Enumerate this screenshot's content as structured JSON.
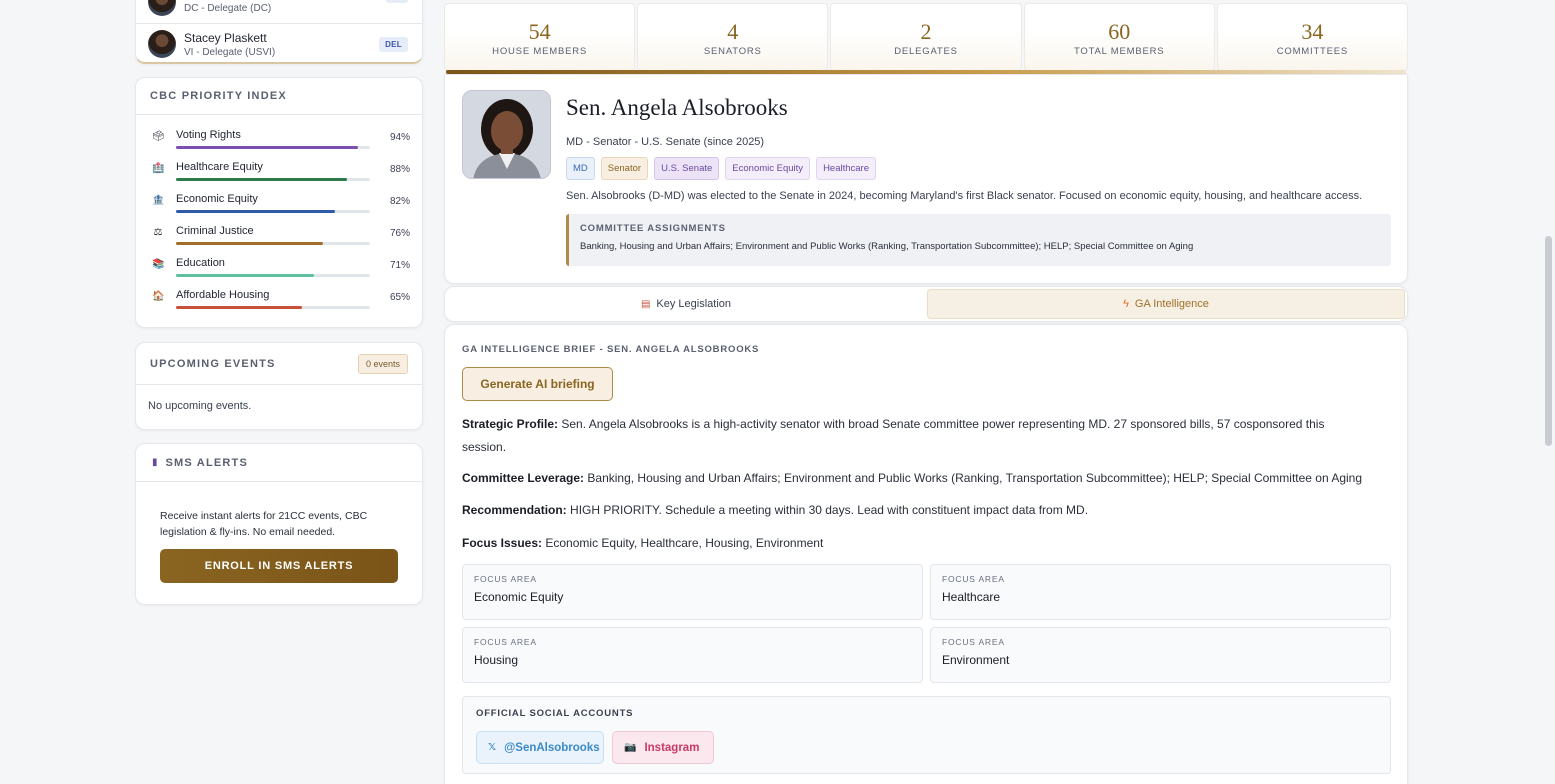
{
  "members": [
    {
      "name": "",
      "role": "DC - Delegate (DC)",
      "badge": ""
    },
    {
      "name": "Stacey Plaskett",
      "role": "VI - Delegate (USVI)",
      "badge": "DEL"
    }
  ],
  "priority_index": {
    "title": "CBC PRIORITY INDEX",
    "items": [
      {
        "label": "Voting Rights",
        "percent": "94%",
        "value": 0.94,
        "color": "#7a4fb0",
        "icon": "ballot-box-icon",
        "glyph": "🗳"
      },
      {
        "label": "Healthcare Equity",
        "percent": "88%",
        "value": 0.88,
        "color": "#2f7a4a",
        "icon": "hospital-icon",
        "glyph": "🏥"
      },
      {
        "label": "Economic Equity",
        "percent": "82%",
        "value": 0.82,
        "color": "#2f5aa8",
        "icon": "bank-icon",
        "glyph": "🏦"
      },
      {
        "label": "Criminal Justice",
        "percent": "76%",
        "value": 0.76,
        "color": "#a0702a",
        "icon": "scales-icon",
        "glyph": "⚖"
      },
      {
        "label": "Education",
        "percent": "71%",
        "value": 0.71,
        "color": "#5fbfa0",
        "icon": "books-icon",
        "glyph": "📚"
      },
      {
        "label": "Affordable Housing",
        "percent": "65%",
        "value": 0.65,
        "color": "#c8503a",
        "icon": "house-icon",
        "glyph": "🏠"
      }
    ]
  },
  "events": {
    "title": "UPCOMING EVENTS",
    "badge": "0 events",
    "empty": "No upcoming events."
  },
  "sms": {
    "title": "SMS ALERTS",
    "text": "Receive instant alerts for 21CC events, CBC legislation & fly-ins. No email needed.",
    "button": "ENROLL IN SMS ALERTS",
    "icon": "phone-icon"
  },
  "stats": [
    {
      "num": "54",
      "label": "HOUSE MEMBERS"
    },
    {
      "num": "4",
      "label": "SENATORS"
    },
    {
      "num": "2",
      "label": "DELEGATES"
    },
    {
      "num": "60",
      "label": "TOTAL MEMBERS"
    },
    {
      "num": "34",
      "label": "COMMITTEES"
    }
  ],
  "profile": {
    "name": "Sen. Angela Alsobrooks",
    "subtitle": "MD - Senator - U.S. Senate (since 2025)",
    "tags": [
      {
        "label": "MD",
        "color": "#3a6ab8",
        "bg": "#eaf1fb",
        "border": "#c8d8ef"
      },
      {
        "label": "Senator",
        "color": "#8a6520",
        "bg": "#f8efe2",
        "border": "#e8d8b8"
      },
      {
        "label": "U.S. Senate",
        "color": "#6a4aa0",
        "bg": "#ece4f6",
        "border": "#d4c4ec"
      },
      {
        "label": "Economic Equity",
        "color": "#6a4aa0",
        "bg": "#f3eefa",
        "border": "#e0d4f0"
      },
      {
        "label": "Healthcare",
        "color": "#6a4aa0",
        "bg": "#f3eefa",
        "border": "#e0d4f0"
      }
    ],
    "bio": "Sen. Alsobrooks (D-MD) was elected to the Senate in 2024, becoming Maryland's first Black senator. Focused on economic equity, housing, and healthcare access.",
    "committee_title": "COMMITTEE ASSIGNMENTS",
    "committees": "Banking, Housing and Urban Affairs; Environment and Public Works (Ranking, Transportation Subcommittee); HELP; Special Committee on Aging"
  },
  "tabs": [
    {
      "label": "Key Legislation",
      "icon": "clipboard-icon",
      "active": false
    },
    {
      "label": "GA Intelligence",
      "icon": "lightning-icon",
      "active": true
    }
  ],
  "brief": {
    "title": "GA INTELLIGENCE BRIEF - SEN. ANGELA ALSOBROOKS",
    "button": "Generate AI briefing",
    "strategic_label": "Strategic Profile:",
    "strategic_text": "Sen. Angela Alsobrooks is a high-activity senator with broad Senate committee power representing MD. 27 sponsored bills, 57 cosponsored this session.",
    "leverage_label": "Committee Leverage:",
    "leverage_text": "Banking, Housing and Urban Affairs; Environment and Public Works (Ranking, Transportation Subcommittee); HELP; Special Committee on Aging",
    "recommendation_label": "Recommendation:",
    "recommendation_text": "HIGH PRIORITY. Schedule a meeting within 30 days. Lead with constituent impact data from MD.",
    "focus_label": "Focus Issues:",
    "focus_text": "Economic Equity, Healthcare, Housing, Environment",
    "focus_areas": [
      {
        "label": "FOCUS AREA",
        "value": "Economic Equity"
      },
      {
        "label": "FOCUS AREA",
        "value": "Healthcare"
      },
      {
        "label": "FOCUS AREA",
        "value": "Housing"
      },
      {
        "label": "FOCUS AREA",
        "value": "Environment"
      }
    ],
    "social_title": "OFFICIAL SOCIAL ACCOUNTS",
    "social": [
      {
        "label": "@SenAlsobrooks",
        "icon": "x-icon",
        "glyph": "𝕏"
      },
      {
        "label": "Instagram",
        "icon": "camera-icon",
        "glyph": "📷"
      }
    ]
  }
}
